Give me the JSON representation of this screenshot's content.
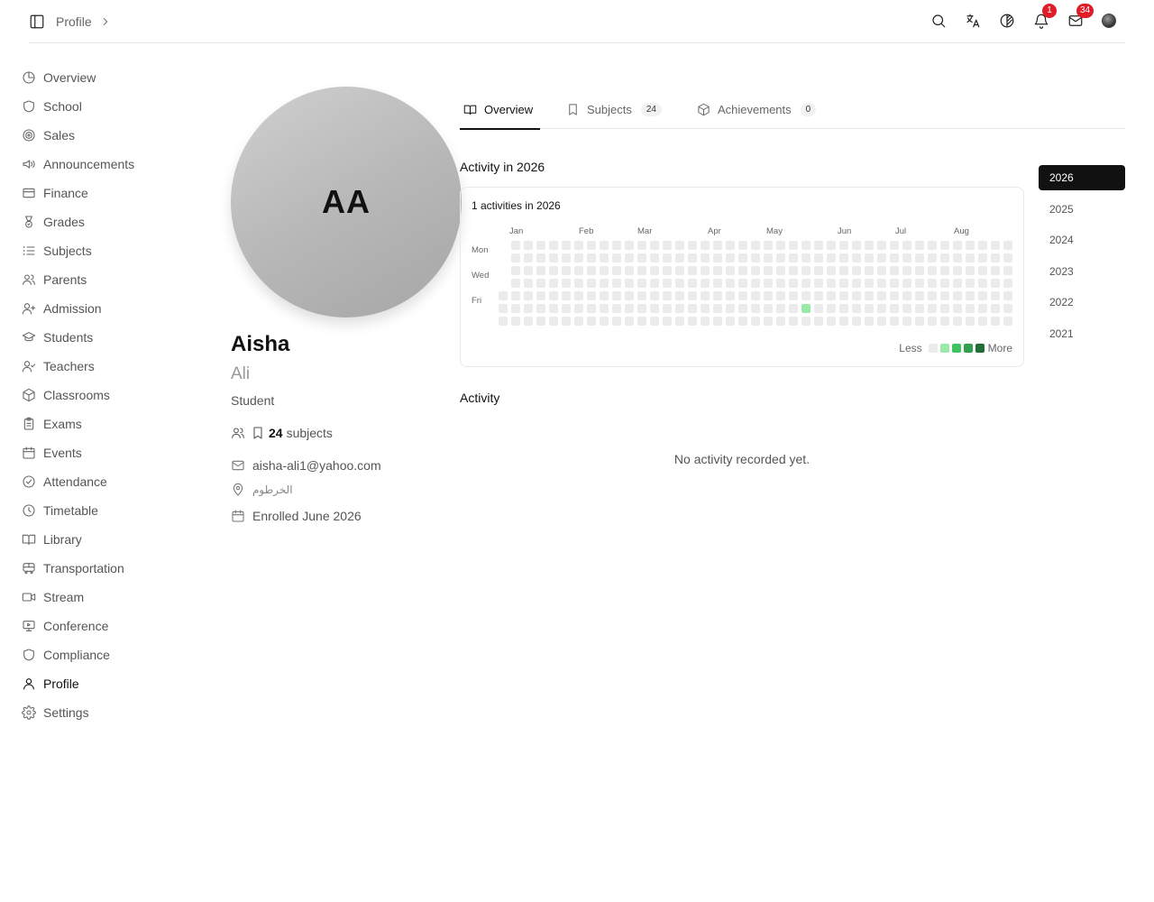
{
  "header": {
    "breadcrumb": "Profile",
    "notifications_count": "1",
    "messages_count": "34"
  },
  "sidebar": {
    "items": [
      {
        "label": "Overview",
        "icon": "pie-chart-icon"
      },
      {
        "label": "School",
        "icon": "shield-icon"
      },
      {
        "label": "Sales",
        "icon": "target-icon"
      },
      {
        "label": "Announcements",
        "icon": "megaphone-icon"
      },
      {
        "label": "Finance",
        "icon": "credit-card-icon"
      },
      {
        "label": "Grades",
        "icon": "medal-icon"
      },
      {
        "label": "Subjects",
        "icon": "list-icon"
      },
      {
        "label": "Parents",
        "icon": "users-icon"
      },
      {
        "label": "Admission",
        "icon": "user-plus-icon"
      },
      {
        "label": "Students",
        "icon": "graduation-cap-icon"
      },
      {
        "label": "Teachers",
        "icon": "user-check-icon"
      },
      {
        "label": "Classrooms",
        "icon": "box-icon"
      },
      {
        "label": "Exams",
        "icon": "clipboard-icon"
      },
      {
        "label": "Events",
        "icon": "calendar-icon"
      },
      {
        "label": "Attendance",
        "icon": "check-circle-icon"
      },
      {
        "label": "Timetable",
        "icon": "clock-icon"
      },
      {
        "label": "Library",
        "icon": "book-open-icon"
      },
      {
        "label": "Transportation",
        "icon": "bus-icon"
      },
      {
        "label": "Stream",
        "icon": "video-icon"
      },
      {
        "label": "Conference",
        "icon": "monitor-icon"
      },
      {
        "label": "Compliance",
        "icon": "shield-icon"
      },
      {
        "label": "Profile",
        "icon": "user-icon",
        "active": true
      },
      {
        "label": "Settings",
        "icon": "gear-icon"
      }
    ]
  },
  "profile": {
    "initials": "AA",
    "first_name": "Aisha",
    "last_name": "Ali",
    "role": "Student",
    "subjects_count": "24",
    "subjects_label": "subjects",
    "email": "aisha-ali1@yahoo.com",
    "location": "الخرطوم",
    "enrolled": "Enrolled June 2026"
  },
  "tabs": [
    {
      "label": "Overview",
      "icon": "book-open-icon",
      "active": true
    },
    {
      "label": "Subjects",
      "icon": "bookmark-icon",
      "count": "24"
    },
    {
      "label": "Achievements",
      "icon": "box-icon",
      "count": "0"
    }
  ],
  "activity": {
    "title": "Activity in 2026",
    "count_label": "1 activities in 2026",
    "months": [
      "Jan",
      "Feb",
      "Mar",
      "Apr",
      "May",
      "Jun",
      "Jul",
      "Aug"
    ],
    "day_labels": [
      "Mon",
      "Wed",
      "Fri"
    ],
    "legend_less": "Less",
    "legend_more": "More",
    "legend_colors": [
      "#ebebeb",
      "#9be9a8",
      "#40c463",
      "#30a14e",
      "#216e39"
    ],
    "empty_color": "#ebebeb",
    "active_cells": [
      {
        "week": 24,
        "day": 5,
        "level": 1
      }
    ]
  },
  "years": [
    {
      "label": "2026",
      "active": true
    },
    {
      "label": "2025"
    },
    {
      "label": "2024"
    },
    {
      "label": "2023"
    },
    {
      "label": "2022"
    },
    {
      "label": "2021"
    }
  ],
  "feed": {
    "title": "Activity",
    "empty_text": "No activity recorded yet."
  }
}
